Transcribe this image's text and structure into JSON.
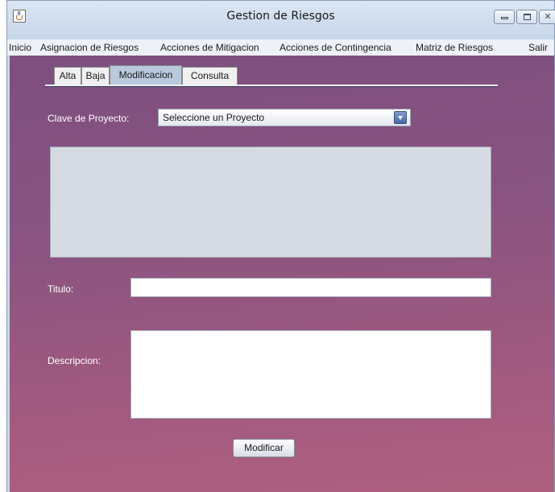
{
  "window": {
    "title": "Gestion de Riesgos",
    "controls": {
      "minimize_icon": "minimize-icon",
      "maximize_icon": "maximize-icon",
      "close_icon": "close-icon",
      "close_glyph": "✕"
    }
  },
  "menu": {
    "items": [
      {
        "label": "Inicio"
      },
      {
        "label": "Asignacion de Riesgos"
      },
      {
        "label": "Acciones de Mitigacion"
      },
      {
        "label": "Acciones de Contingencia"
      },
      {
        "label": "Matriz de Riesgos"
      },
      {
        "label": "Salir"
      }
    ]
  },
  "tabs": {
    "items": [
      {
        "label": "Alta"
      },
      {
        "label": "Baja"
      },
      {
        "label": "Modificacion",
        "active": true
      },
      {
        "label": "Consulta"
      }
    ]
  },
  "form": {
    "proyecto_label": "Clave de Proyecto:",
    "proyecto_value": "Seleccione un Proyecto",
    "titulo_label": "Titulo:",
    "titulo_value": "",
    "descripcion_label": "Descripcion:",
    "descripcion_value": "",
    "submit_label": "Modificar"
  },
  "colors": {
    "background_top": "#7d4f7f",
    "background_bottom": "#b0607f",
    "active_tab": "#b9c8dc",
    "label_text": "#ffffff"
  }
}
